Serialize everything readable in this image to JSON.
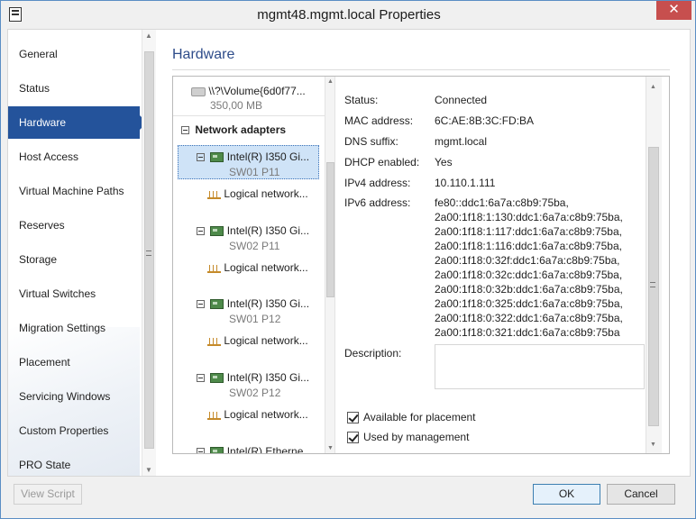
{
  "window": {
    "title": "mgmt48.mgmt.local Properties",
    "close_label": "✕"
  },
  "nav": {
    "items": [
      {
        "label": "General"
      },
      {
        "label": "Status"
      },
      {
        "label": "Hardware"
      },
      {
        "label": "Host Access"
      },
      {
        "label": "Virtual Machine Paths"
      },
      {
        "label": "Reserves"
      },
      {
        "label": "Storage"
      },
      {
        "label": "Virtual Switches"
      },
      {
        "label": "Migration Settings"
      },
      {
        "label": "Placement"
      },
      {
        "label": "Servicing Windows"
      },
      {
        "label": "Custom Properties"
      },
      {
        "label": "PRO State"
      }
    ],
    "active": "Hardware"
  },
  "main": {
    "title": "Hardware"
  },
  "tree": {
    "volume": {
      "name": "\\\\?\\Volume{6d0f77...",
      "size": "350,00 MB"
    },
    "group_label": "Network adapters",
    "adapters": [
      {
        "name": "Intel(R) I350 Gi...",
        "port": "SW01 P11",
        "network": "Logical network..."
      },
      {
        "name": "Intel(R) I350 Gi...",
        "port": "SW02 P11",
        "network": "Logical network..."
      },
      {
        "name": "Intel(R) I350 Gi...",
        "port": "SW01 P12",
        "network": "Logical network..."
      },
      {
        "name": "Intel(R) I350 Gi...",
        "port": "SW02 P12",
        "network": "Logical network..."
      },
      {
        "name": "Intel(R) Etherne..."
      }
    ]
  },
  "details": {
    "status_label": "Status:",
    "status_value": "Connected",
    "mac_label": "MAC address:",
    "mac_value": "6C:AE:8B:3C:FD:BA",
    "dns_label": "DNS suffix:",
    "dns_value": "mgmt.local",
    "dhcp_label": "DHCP enabled:",
    "dhcp_value": "Yes",
    "ipv4_label": "IPv4 address:",
    "ipv4_value": "10.110.1.111",
    "ipv6_label": "IPv6 address:",
    "ipv6_values": [
      "fe80::ddc1:6a7a:c8b9:75ba,",
      "2a00:1f18:1:130:ddc1:6a7a:c8b9:75ba,",
      "2a00:1f18:1:117:ddc1:6a7a:c8b9:75ba,",
      "2a00:1f18:1:116:ddc1:6a7a:c8b9:75ba,",
      "2a00:1f18:0:32f:ddc1:6a7a:c8b9:75ba,",
      "2a00:1f18:0:32c:ddc1:6a7a:c8b9:75ba,",
      "2a00:1f18:0:32b:ddc1:6a7a:c8b9:75ba,",
      "2a00:1f18:0:325:ddc1:6a7a:c8b9:75ba,",
      "2a00:1f18:0:322:ddc1:6a7a:c8b9:75ba,",
      "2a00:1f18:0:321:ddc1:6a7a:c8b9:75ba"
    ],
    "description_label": "Description:",
    "description_value": "",
    "available_label": "Available for placement",
    "available_checked": true,
    "management_label": "Used by management",
    "management_checked": true
  },
  "footer": {
    "view_script": "View Script",
    "ok": "OK",
    "cancel": "Cancel"
  }
}
